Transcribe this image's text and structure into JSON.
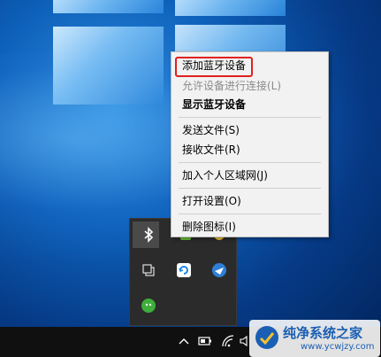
{
  "context_menu": {
    "items": [
      {
        "label": "添加蓝牙设备",
        "state": "normal"
      },
      {
        "label": "允许设备进行连接(L)",
        "state": "disabled"
      },
      {
        "label": "显示蓝牙设备",
        "state": "default"
      },
      {
        "label": "发送文件(S)",
        "state": "normal"
      },
      {
        "label": "接收文件(R)",
        "state": "normal"
      },
      {
        "label": "加入个人区域网(J)",
        "state": "normal"
      },
      {
        "label": "打开设置(O)",
        "state": "normal"
      },
      {
        "label": "删除图标(I)",
        "state": "normal"
      }
    ],
    "highlight_color": "#e0211f"
  },
  "tray_overflow": {
    "icons": [
      "bluetooth-icon",
      "app-icon-green",
      "app-icon-yellow",
      "copy-icon",
      "sync-icon",
      "browser-icon",
      "wechat-icon"
    ]
  },
  "taskbar": {
    "icons": [
      "chevron-up-icon",
      "battery-icon",
      "wifi-icon",
      "volume-icon"
    ]
  },
  "watermark": {
    "title": "纯净系统之家",
    "url": "www.ycwjzy.com"
  }
}
